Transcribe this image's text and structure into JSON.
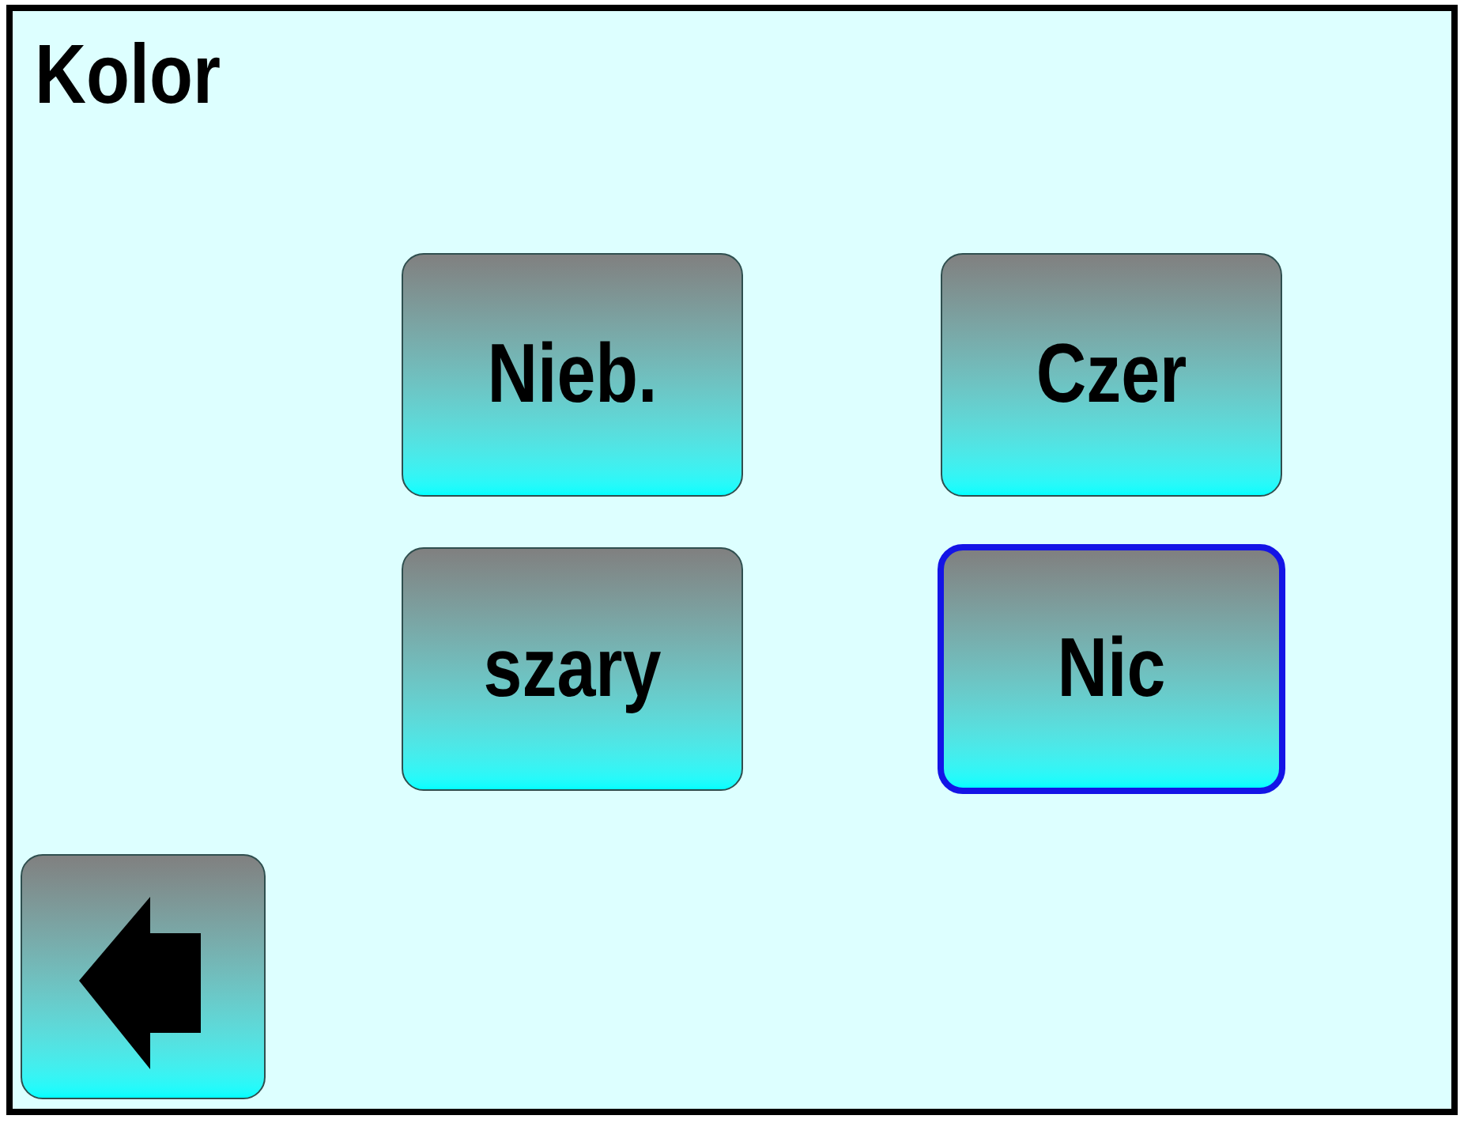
{
  "screen": {
    "title": "Kolor"
  },
  "options": [
    {
      "label": "Nieb.",
      "selected": false
    },
    {
      "label": "Czer",
      "selected": false
    },
    {
      "label": "szary",
      "selected": false
    },
    {
      "label": "Nic",
      "selected": true
    }
  ]
}
